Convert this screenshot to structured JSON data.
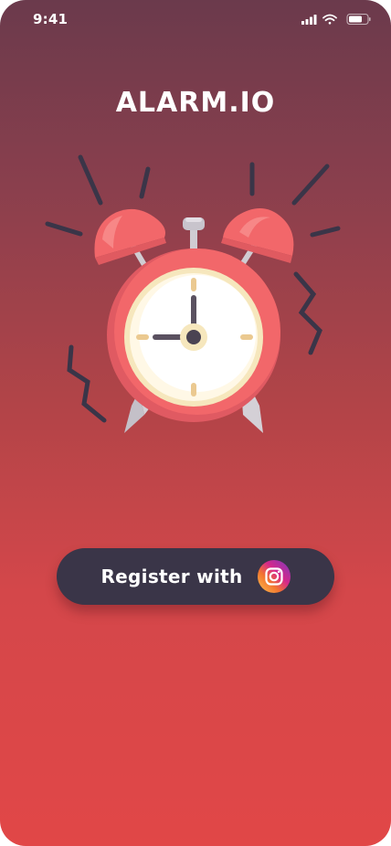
{
  "status_bar": {
    "time": "9:41",
    "icons": [
      "signal-icon",
      "wifi-icon",
      "battery-icon"
    ]
  },
  "app": {
    "title": "ALARM.IO"
  },
  "illustration": {
    "name": "alarm-clock-icon",
    "shown_time": "9:00"
  },
  "register": {
    "label": "Register with",
    "provider_icon": "instagram-icon"
  },
  "colors": {
    "gradient_top": "#6b3a4c",
    "gradient_bottom": "#e14747",
    "button_bg": "#3a3548",
    "clock_red": "#f2676a",
    "clock_face": "#fff8e6"
  }
}
